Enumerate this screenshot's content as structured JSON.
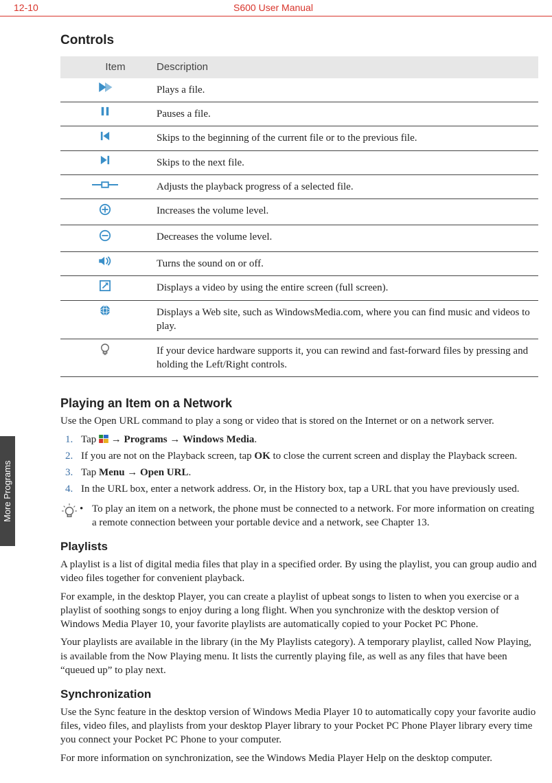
{
  "header": {
    "page_number": "12-10",
    "doc_title": "S600 User Manual"
  },
  "side_tab": "More Programs",
  "section_controls": {
    "heading": "Controls",
    "col_item": "Item",
    "col_desc": "Description",
    "rows": [
      {
        "icon": "play-icon",
        "desc": "Plays a file."
      },
      {
        "icon": "pause-icon",
        "desc": "Pauses a file."
      },
      {
        "icon": "prev-icon",
        "desc": "Skips to the beginning of the current file or to the previous file."
      },
      {
        "icon": "next-icon",
        "desc": "Skips to the next file."
      },
      {
        "icon": "progress-icon",
        "desc": "Adjusts the playback progress of a selected file."
      },
      {
        "icon": "vol-up-icon",
        "desc": "Increases the volume level."
      },
      {
        "icon": "vol-down-icon",
        "desc": "Decreases the volume level."
      },
      {
        "icon": "mute-icon",
        "desc": "Turns the sound on or off."
      },
      {
        "icon": "fullscreen-icon",
        "desc": "Displays a video by using the entire screen (full screen)."
      },
      {
        "icon": "web-icon",
        "desc": "Displays a Web site, such as WindowsMedia.com, where you can find music and videos to play."
      },
      {
        "icon": "tip-bulb-icon",
        "desc": "If your device hardware supports it, you can rewind and fast-forward files by pressing and holding the Left/Right controls."
      }
    ]
  },
  "section_network": {
    "heading": "Playing an Item on a Network",
    "intro": "Use the Open URL command to play a song or video that is stored on the Internet or on a network server.",
    "steps": {
      "s1_pre": "Tap ",
      "s1_post": " → ",
      "s1_b1": "Programs",
      "s1_mid": " → ",
      "s1_b2": "Windows Media",
      "s1_end": ".",
      "s2_pre": "If you are not on the Playback screen, tap ",
      "s2_b": "OK",
      "s2_post": " to close the current screen and display the Playback screen.",
      "s3_pre": "Tap ",
      "s3_b": "Menu → Open URL",
      "s3_post": ".",
      "s4": "In the URL box, enter a network address. Or, in the History box, tap a URL that you have previously used."
    },
    "tip": "To play an item on a network, the phone must be connected to a network. For more information on creating a remote connection between your portable device and a network, see Chapter 13."
  },
  "section_playlists": {
    "heading": "Playlists",
    "p1": "A playlist is a list of digital media files that play in a specified order. By using the playlist, you can group audio and video files together for convenient playback.",
    "p2": "For example, in the desktop Player, you can create a playlist of upbeat songs to listen to when you exercise or a playlist of soothing songs to enjoy during a long flight. When you synchronize with the desktop version of Windows Media Player 10, your favorite playlists are automatically copied to your Pocket PC Phone.",
    "p3": "Your playlists are available in the library (in the My Playlists category). A temporary playlist, called Now Playing, is available from the Now Playing menu. It lists the currently playing file, as well as any files that have been “queued up” to play next."
  },
  "section_sync": {
    "heading": "Synchronization",
    "p1": "Use the Sync feature in the desktop version of Windows Media Player 10 to automatically copy your favorite audio files, video files, and playlists from your desktop Player library to your Pocket PC Phone Player library every time you connect your Pocket PC Phone to your computer.",
    "p2": "For more information on synchronization, see the Windows Media Player Help on the desktop computer."
  }
}
